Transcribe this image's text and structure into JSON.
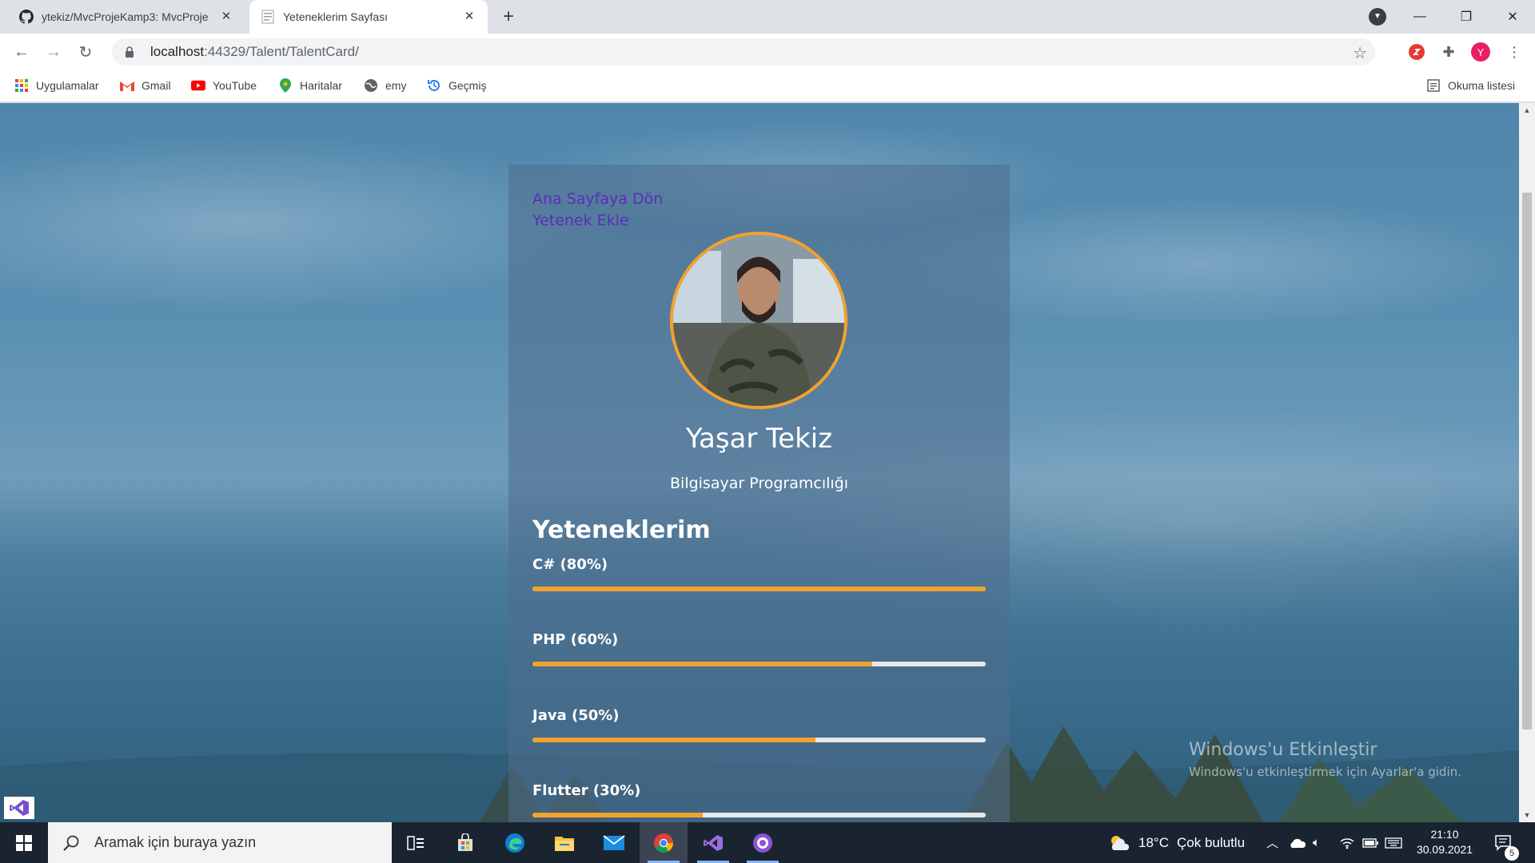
{
  "browser": {
    "tabs": [
      {
        "title": "ytekiz/MvcProjeKamp3: MvcProje",
        "active": false
      },
      {
        "title": "Yeteneklerim Sayfası",
        "active": true
      }
    ],
    "address": {
      "host": "localhost",
      "path": ":44329/Talent/TalentCard/"
    },
    "profile_initial": "Y",
    "bookmarks": [
      {
        "label": "Uygulamalar",
        "icon": "apps-grid-icon"
      },
      {
        "label": "Gmail",
        "icon": "gmail-icon"
      },
      {
        "label": "YouTube",
        "icon": "youtube-icon"
      },
      {
        "label": "Haritalar",
        "icon": "maps-pin-icon"
      },
      {
        "label": "emy",
        "icon": "globe-icon"
      },
      {
        "label": "Geçmiş",
        "icon": "history-icon"
      }
    ],
    "reading_list": "Okuma listesi"
  },
  "page": {
    "links": [
      "Ana Sayfaya Dön",
      "Yetenek Ekle"
    ],
    "name": "Yaşar Tekiz",
    "title": "Bilgisayar Programcılığı",
    "skills_heading": "Yeteneklerim",
    "skills": [
      {
        "label": "C# (80%)",
        "level": 1.0
      },
      {
        "label": "PHP (60%)",
        "level": 0.75
      },
      {
        "label": "Java (50%)",
        "level": 0.625
      },
      {
        "label": "Flutter (30%)",
        "level": 0.375
      }
    ]
  },
  "watermark": {
    "line1": "Windows'u Etkinleştir",
    "line2": "Windows'u etkinleştirmek için Ayarlar'a gidin."
  },
  "taskbar": {
    "search_placeholder": "Aramak için buraya yazın",
    "weather_temp": "18°C",
    "weather_text": "Çok bulutlu",
    "time": "21:10",
    "date": "30.09.2021",
    "notifications": "5"
  },
  "colors": {
    "accent": "#f0a22f",
    "link": "#5b2db8",
    "taskbar": "#1a2430"
  }
}
